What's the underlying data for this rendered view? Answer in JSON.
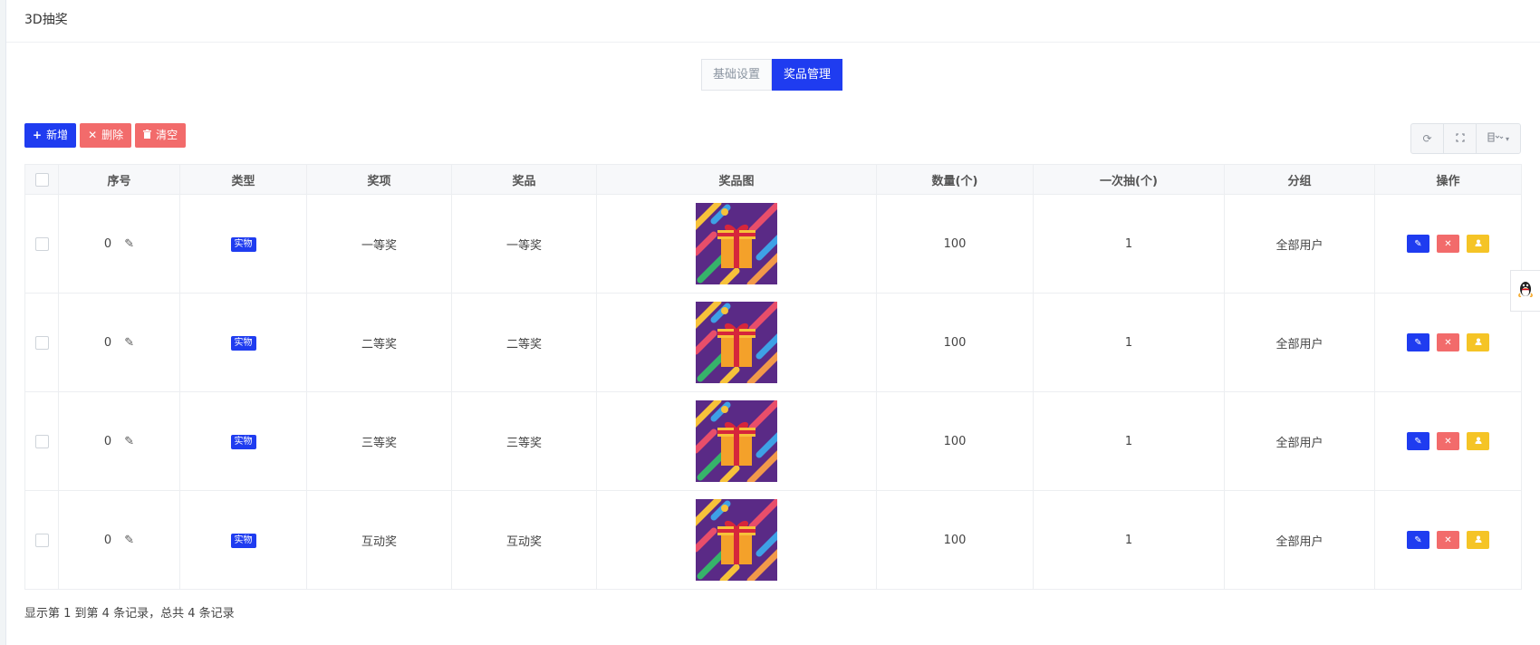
{
  "header": {
    "title": "3D抽奖"
  },
  "tabs": [
    {
      "label": "基础设置",
      "active": false
    },
    {
      "label": "奖品管理",
      "active": true
    }
  ],
  "toolbar": {
    "add_label": "新增",
    "delete_label": "删除",
    "clear_label": "清空"
  },
  "table": {
    "columns": [
      "序号",
      "类型",
      "奖项",
      "奖品",
      "奖品图",
      "数量(个)",
      "一次抽(个)",
      "分组",
      "操作"
    ],
    "rows": [
      {
        "order": "0",
        "type": "实物",
        "award": "一等奖",
        "prize": "一等奖",
        "quantity": "100",
        "per_draw": "1",
        "group": "全部用户"
      },
      {
        "order": "0",
        "type": "实物",
        "award": "二等奖",
        "prize": "二等奖",
        "quantity": "100",
        "per_draw": "1",
        "group": "全部用户"
      },
      {
        "order": "0",
        "type": "实物",
        "award": "三等奖",
        "prize": "三等奖",
        "quantity": "100",
        "per_draw": "1",
        "group": "全部用户"
      },
      {
        "order": "0",
        "type": "实物",
        "award": "互动奖",
        "prize": "互动奖",
        "quantity": "100",
        "per_draw": "1",
        "group": "全部用户"
      }
    ]
  },
  "footer": {
    "info": "显示第 1 到第 4 条记录，总共 4 条记录"
  },
  "icons": {
    "add": "plus-icon",
    "delete": "close-icon",
    "clear": "trash-icon",
    "refresh": "refresh-icon",
    "fullscreen": "fullscreen-icon",
    "columns": "columns-icon",
    "edit": "pencil-icon",
    "user": "user-icon",
    "qq": "qq-penguin-icon"
  },
  "colors": {
    "primary": "#1f3cf0",
    "danger": "#f26b6b",
    "warning": "#f5c426"
  }
}
